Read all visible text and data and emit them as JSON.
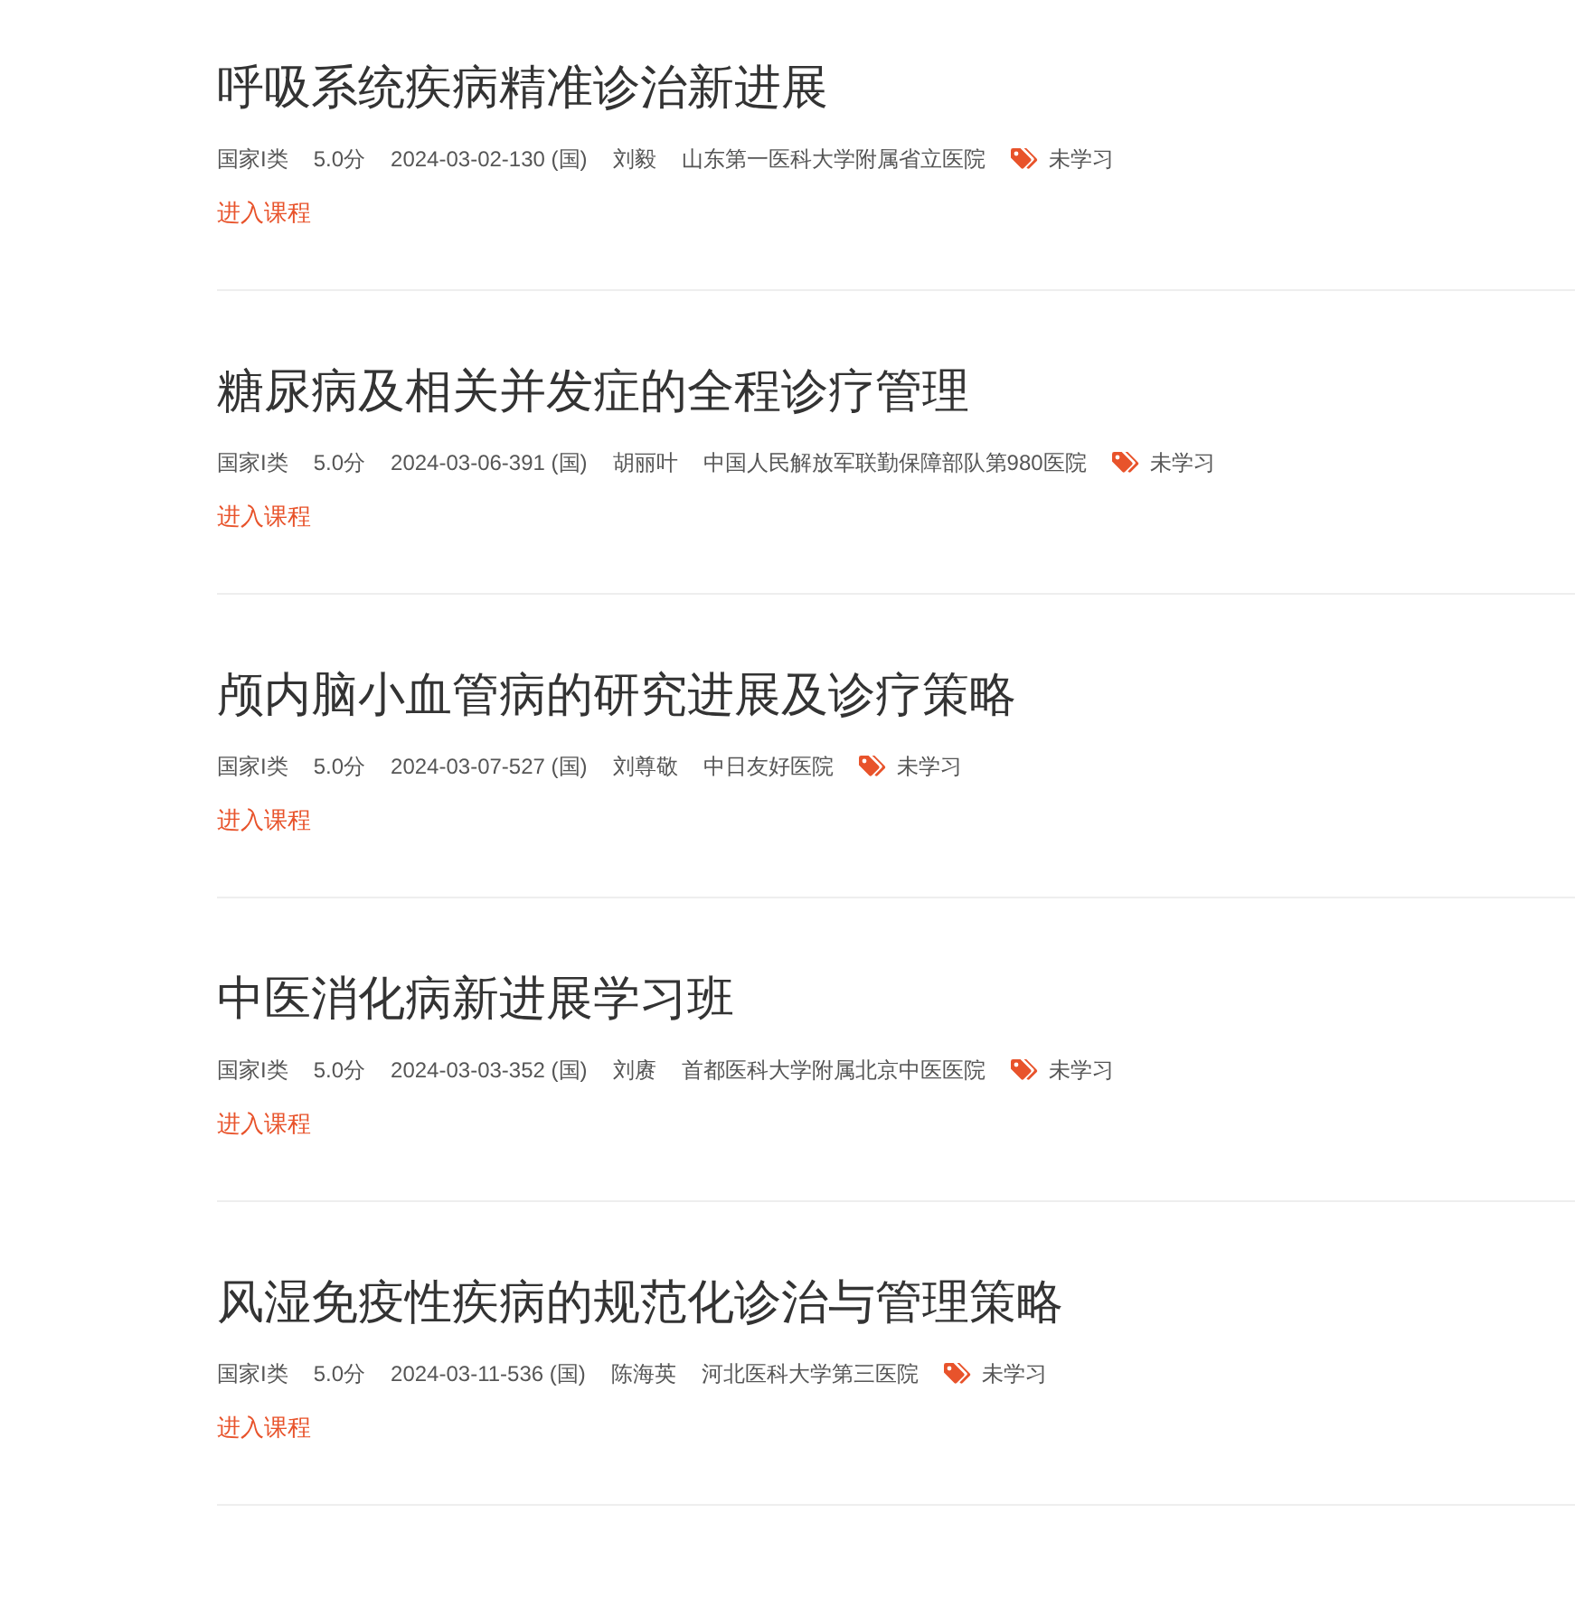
{
  "courses": [
    {
      "title": "呼吸系统疾病精准诊治新进展",
      "category": "国家I类",
      "credit": "5.0分",
      "code": "2024-03-02-130 (国)",
      "lecturer": "刘毅",
      "institution": "山东第一医科大学附属省立医院",
      "status": "未学习",
      "link": "进入课程"
    },
    {
      "title": "糖尿病及相关并发症的全程诊疗管理",
      "category": "国家I类",
      "credit": "5.0分",
      "code": "2024-03-06-391 (国)",
      "lecturer": "胡丽叶",
      "institution": "中国人民解放军联勤保障部队第980医院",
      "status": "未学习",
      "link": "进入课程"
    },
    {
      "title": "颅内脑小血管病的研究进展及诊疗策略",
      "category": "国家I类",
      "credit": "5.0分",
      "code": "2024-03-07-527 (国)",
      "lecturer": "刘尊敬",
      "institution": "中日友好医院",
      "status": "未学习",
      "link": "进入课程"
    },
    {
      "title": "中医消化病新进展学习班",
      "category": "国家I类",
      "credit": "5.0分",
      "code": "2024-03-03-352 (国)",
      "lecturer": "刘赓",
      "institution": "首都医科大学附属北京中医医院",
      "status": "未学习",
      "link": "进入课程"
    },
    {
      "title": "风湿免疫性疾病的规范化诊治与管理策略",
      "category": "国家I类",
      "credit": "5.0分",
      "code": "2024-03-11-536 (国)",
      "lecturer": "陈海英",
      "institution": "河北医科大学第三医院",
      "status": "未学习",
      "link": "进入课程"
    }
  ]
}
